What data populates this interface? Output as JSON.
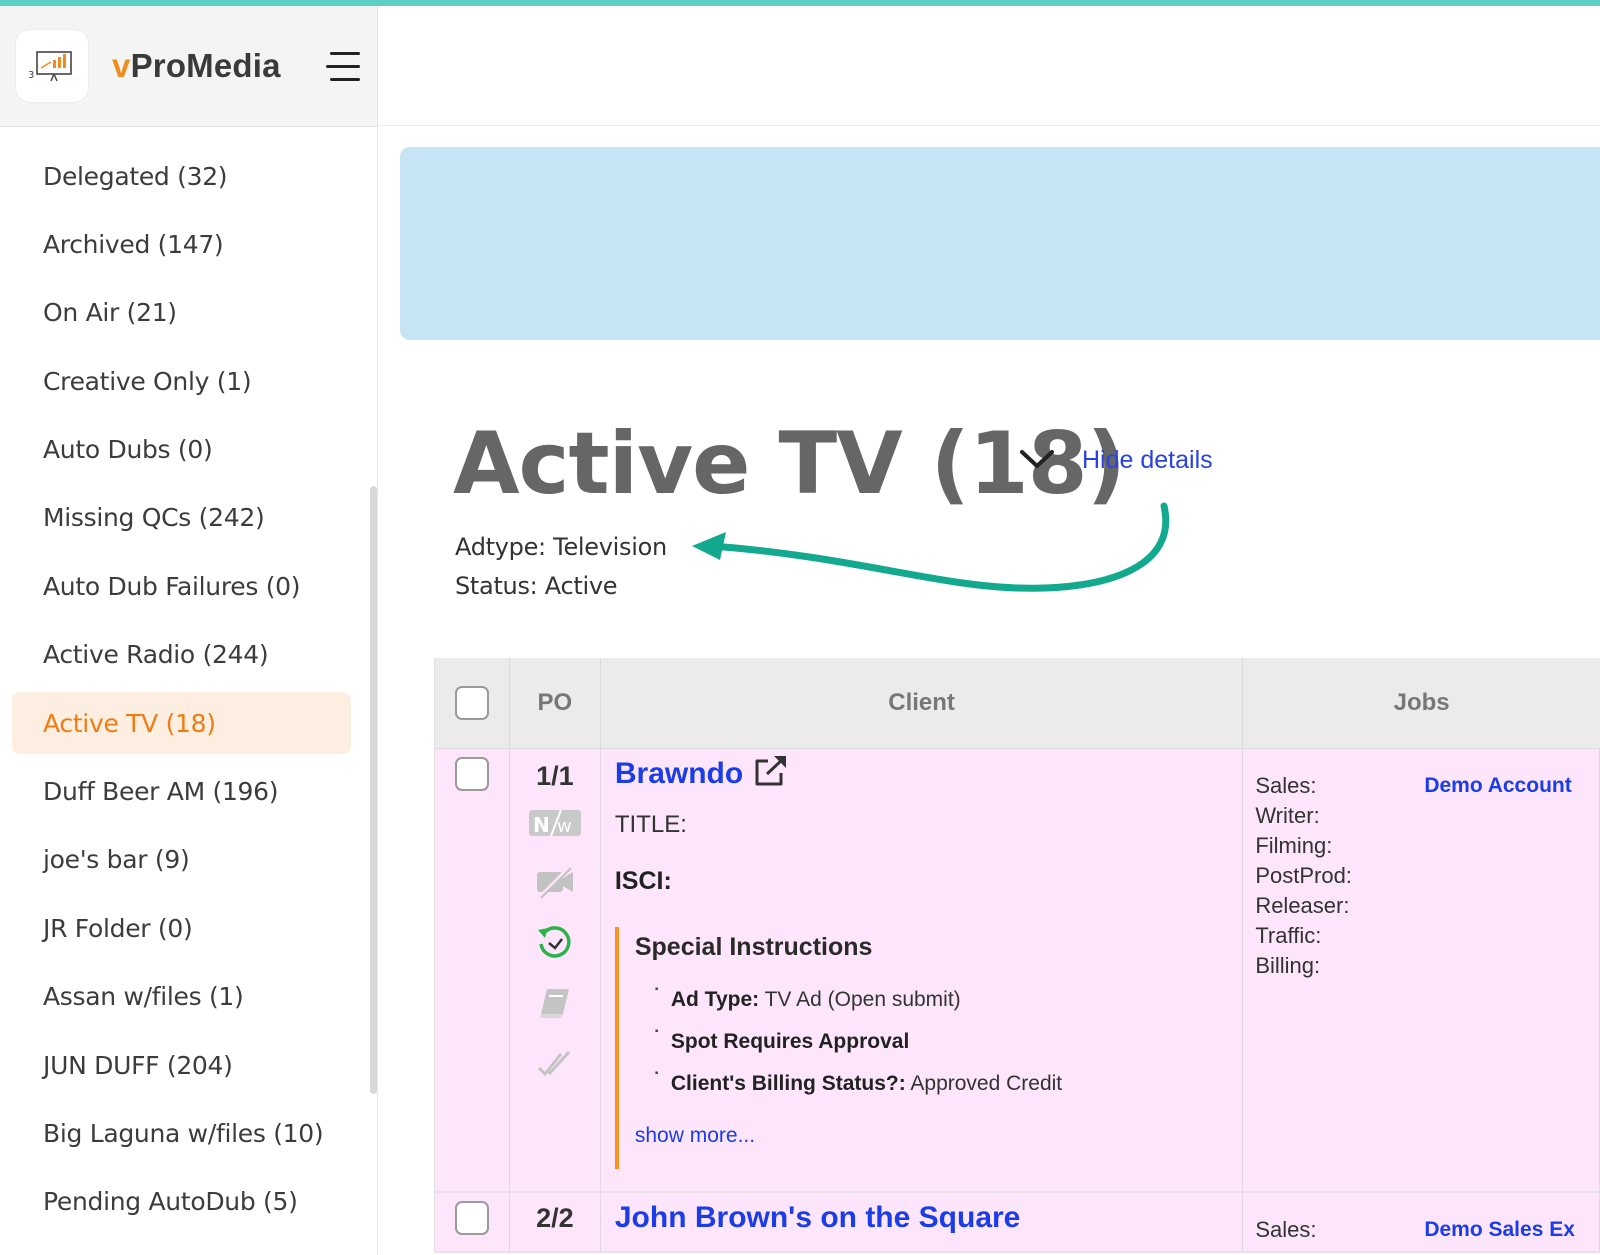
{
  "brand": {
    "v": "v",
    "rest": "ProMedia"
  },
  "sidebar": {
    "items": [
      {
        "label": "Delegated (32)"
      },
      {
        "label": "Archived (147)"
      },
      {
        "label": "On Air (21)"
      },
      {
        "label": "Creative Only (1)"
      },
      {
        "label": "Auto Dubs (0)"
      },
      {
        "label": "Missing QCs (242)"
      },
      {
        "label": "Auto Dub Failures (0)"
      },
      {
        "label": "Active Radio (244)"
      },
      {
        "label": "Active TV (18)"
      },
      {
        "label": "Duff Beer AM (196)"
      },
      {
        "label": "joe's bar (9)"
      },
      {
        "label": "JR Folder (0)"
      },
      {
        "label": "Assan w/files (1)"
      },
      {
        "label": "JUN DUFF (204)"
      },
      {
        "label": "Big Laguna w/files (10)"
      },
      {
        "label": "Pending AutoDub (5)"
      }
    ],
    "active_index": 8
  },
  "page": {
    "title": "Active TV (18)",
    "hide_details": "Hide details",
    "adtype": "Adtype: Television",
    "status": "Status: Active"
  },
  "table": {
    "headers": {
      "po": "PO",
      "client": "Client",
      "jobs": "Jobs"
    },
    "rows": [
      {
        "po": "1/1",
        "client": "Brawndo",
        "title_label": "TITLE:",
        "isci_label": "ISCI:",
        "special_heading": "Special Instructions",
        "instructions": [
          {
            "key": "Ad Type:",
            "value": " TV Ad (Open submit)"
          },
          {
            "key": "Spot Requires Approval",
            "value": ""
          },
          {
            "key": "Client's Billing Status?:",
            "value": " Approved Credit"
          }
        ],
        "show_more": "show more...",
        "job_labels": [
          "Sales:",
          "Writer:",
          "Filming:",
          "PostProd:",
          "Releaser:",
          "Traffic:",
          "Billing:"
        ],
        "job_values": [
          "Demo Account",
          "",
          "",
          "",
          "",
          "",
          ""
        ]
      },
      {
        "po": "2/2",
        "client": "John Brown's on the Square",
        "job_labels": [
          "Sales:"
        ],
        "job_values": [
          "Demo Sales Ex"
        ]
      }
    ]
  },
  "colors": {
    "accent_orange": "#f07d12",
    "link_blue": "#1b3de8",
    "arrow_teal": "#13a98e",
    "banner_blue": "#c7e4f5",
    "row_pink": "#fde6fb"
  }
}
